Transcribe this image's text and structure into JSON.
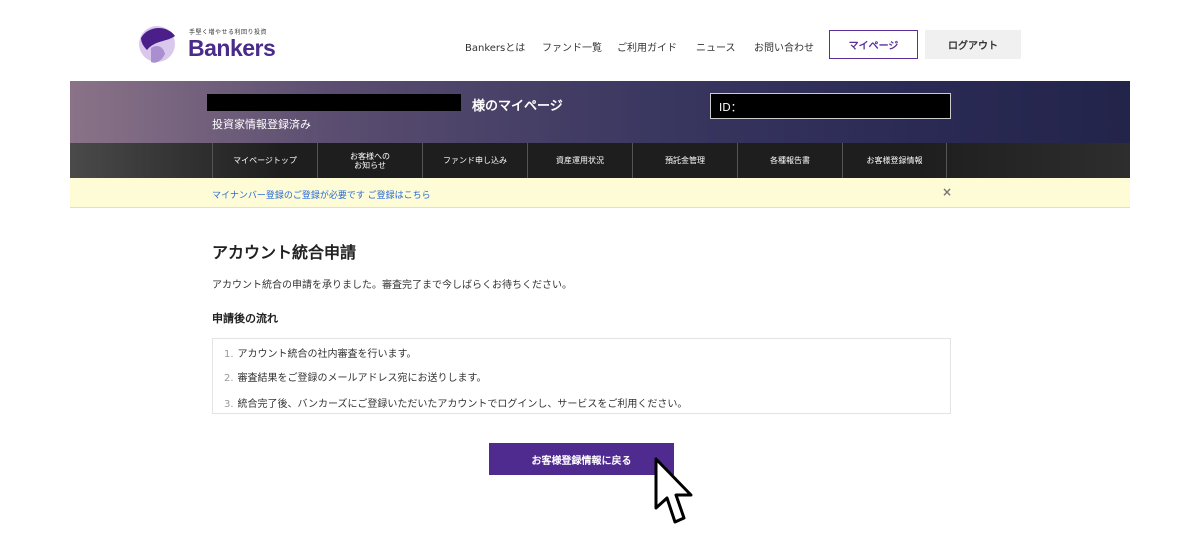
{
  "header": {
    "logo_tagline": "手堅く増やせる利回り投資",
    "logo_name": "Bankers",
    "nav": [
      "Bankersとは",
      "ファンド一覧",
      "ご利用ガイド",
      "ニュース",
      "お問い合わせ"
    ],
    "mypage_button": "マイページ",
    "logout_button": "ログアウト",
    "brand_color": "#4a2a8a"
  },
  "banner": {
    "title_suffix": "様のマイページ",
    "status": "投資家情報登録済み",
    "id_label": "ID："
  },
  "subnav": {
    "items": [
      "マイページトップ",
      "お客様への\nお知らせ",
      "ファンド申し込み",
      "資産運用状況",
      "預託金管理",
      "各種報告書",
      "お客様登録情報"
    ]
  },
  "notice": {
    "text": "マイナンバー登録のご登録が必要です ご登録はこちら",
    "close_icon": "close-icon"
  },
  "main": {
    "title": "アカウント統合申請",
    "intro": "アカウント統合の申請を承りました。審査完了まで今しばらくお待ちください。",
    "flow_heading": "申請後の流れ",
    "flow_items": [
      {
        "num": "1.",
        "text": "アカウント統合の社内審査を行います。"
      },
      {
        "num": "2.",
        "text": "審査結果をご登録のメールアドレス宛にお送りします。"
      },
      {
        "num": "3.",
        "text": "統合完了後、バンカーズにご登録いただいたアカウントでログインし、サービスをご利用ください。"
      }
    ],
    "return_button": "お客様登録情報に戻る"
  },
  "cursor_icon": "pointer-cursor-icon"
}
